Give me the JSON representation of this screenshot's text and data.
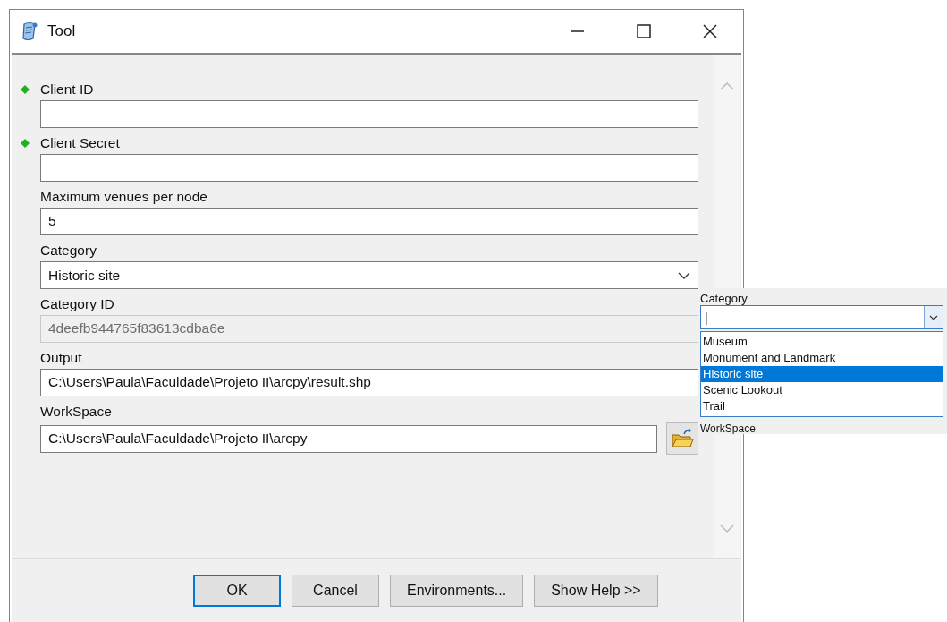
{
  "window": {
    "title": "Tool"
  },
  "fields": [
    {
      "kind": "text",
      "label": "Client ID",
      "required": true
    },
    {
      "kind": "text",
      "label": "Client Secret",
      "required": true
    },
    {
      "kind": "text",
      "label": "Maximum venues per node",
      "required": false,
      "value": "5"
    },
    {
      "kind": "combo",
      "label": "Category",
      "required": false,
      "value": "Historic site"
    },
    {
      "kind": "disabled",
      "label": "Category ID",
      "required": false,
      "value": "4deefb944765f83613cdba6e"
    },
    {
      "kind": "text",
      "label": "Output",
      "required": false,
      "value": "C:\\Users\\Paula\\Faculdade\\Projeto II\\arcpy\\result.shp"
    },
    {
      "kind": "folder",
      "label": "WorkSpace",
      "required": false,
      "value": "C:\\Users\\Paula\\Faculdade\\Projeto II\\arcpy"
    }
  ],
  "buttons": [
    {
      "label": "OK",
      "default": true
    },
    {
      "label": "Cancel",
      "default": false
    },
    {
      "label": "Environments...",
      "default": false
    },
    {
      "label": "Show Help >>",
      "default": false
    }
  ],
  "inset": {
    "label": "Category",
    "value": "|",
    "options": [
      {
        "label": "Museum",
        "selected": false
      },
      {
        "label": "Monument and Landmark",
        "selected": false
      },
      {
        "label": "Historic site",
        "selected": true
      },
      {
        "label": "Scenic Lookout",
        "selected": false
      },
      {
        "label": "Trail",
        "selected": false
      }
    ],
    "next_label": "WorkSpace"
  }
}
